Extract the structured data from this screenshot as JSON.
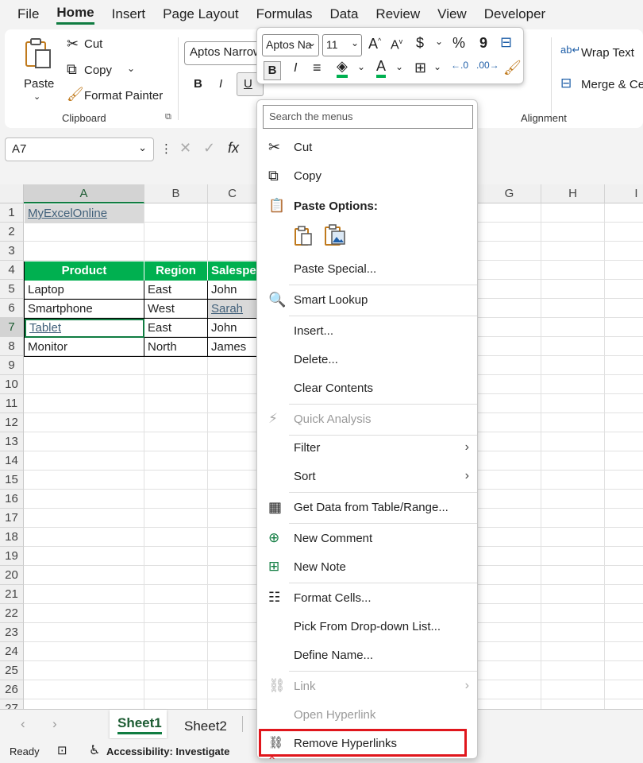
{
  "menubar": {
    "items": [
      "File",
      "Home",
      "Insert",
      "Page Layout",
      "Formulas",
      "Data",
      "Review",
      "View",
      "Developer"
    ],
    "active": "Home"
  },
  "ribbon": {
    "paste_label": "Paste",
    "cut_label": "Cut",
    "copy_label": "Copy",
    "format_painter_label": "Format Painter",
    "clipboard_group": "Clipboard",
    "font_name": "Aptos Narrow",
    "wrap_text_label": "Wrap Text",
    "merge_label": "Merge & Ce",
    "alignment_group": "Alignment"
  },
  "formula_bar": {
    "name_box": "A7",
    "fx": "fx"
  },
  "mini_toolbar": {
    "font": "Aptos Na",
    "size": "11",
    "percent": "%",
    "comma": "9"
  },
  "grid": {
    "columns": [
      "A",
      "B",
      "C",
      "G",
      "H",
      "I"
    ],
    "rows": [
      "1",
      "2",
      "3",
      "4",
      "5",
      "6",
      "7",
      "8",
      "9",
      "10",
      "11",
      "12",
      "13",
      "14",
      "15",
      "16",
      "17",
      "18",
      "19",
      "20",
      "21",
      "22",
      "23",
      "24",
      "25",
      "26",
      "27"
    ],
    "a1": "MyExcelOnline",
    "headers": [
      "Product",
      "Region",
      "Salespe"
    ],
    "data": [
      [
        "Laptop",
        "East",
        "John"
      ],
      [
        "Smartphone",
        "West",
        "Sarah"
      ],
      [
        "Tablet",
        "East",
        "John"
      ],
      [
        "Monitor",
        "North",
        "James"
      ]
    ]
  },
  "sheets": [
    "Sheet1",
    "Sheet2"
  ],
  "status": {
    "ready": "Ready",
    "accessibility": "Accessibility: Investigate"
  },
  "context_menu": {
    "search_placeholder": "Search the menus",
    "cut": "Cut",
    "copy": "Copy",
    "paste_options": "Paste Options:",
    "paste_special": "Paste Special...",
    "smart_lookup": "Smart Lookup",
    "insert": "Insert...",
    "delete": "Delete...",
    "clear_contents": "Clear Contents",
    "quick_analysis": "Quick Analysis",
    "filter": "Filter",
    "sort": "Sort",
    "get_data": "Get Data from Table/Range...",
    "new_comment": "New Comment",
    "new_note": "New Note",
    "format_cells": "Format Cells...",
    "pick_dropdown": "Pick From Drop-down List...",
    "define_name": "Define Name...",
    "link": "Link",
    "open_hyperlink": "Open Hyperlink",
    "remove_hyperlinks": "Remove Hyperlinks"
  },
  "colors": {
    "accent": "#107c41",
    "table_header": "#00b050",
    "highlight": "#e0161c",
    "link": "#41607a"
  }
}
